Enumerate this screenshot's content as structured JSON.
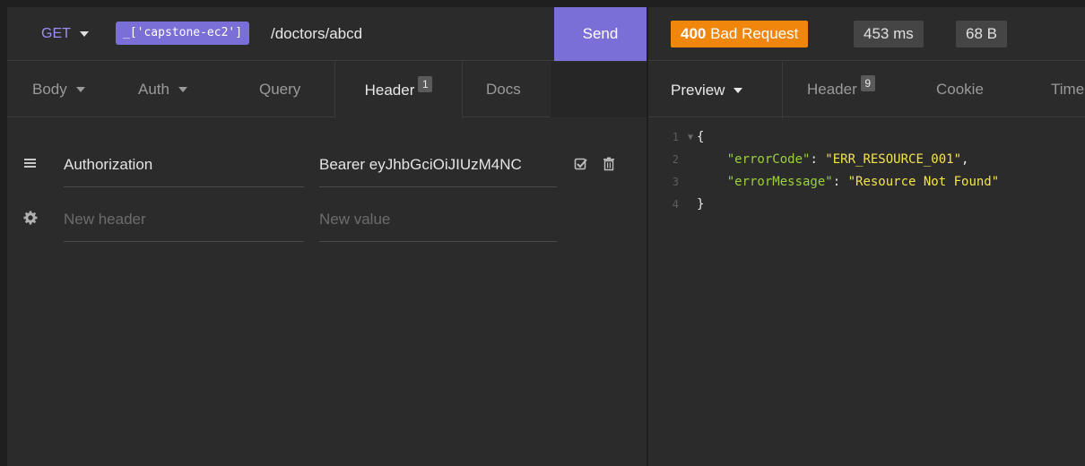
{
  "request": {
    "method": "GET",
    "environment_tag": "_['capstone-ec2']",
    "path": "/doctors/abcd",
    "send_label": "Send"
  },
  "request_tabs": [
    {
      "label": "Body",
      "dropdown": true
    },
    {
      "label": "Auth",
      "dropdown": true
    },
    {
      "label": "Query",
      "dropdown": false
    },
    {
      "label": "Header",
      "badge": "1",
      "active": true
    },
    {
      "label": "Docs",
      "dropdown": false
    }
  ],
  "headers": [
    {
      "name": "Authorization",
      "value": "Bearer eyJhbGciOiJIUzM4NC",
      "icon": "drag-handle-icon"
    }
  ],
  "new_header": {
    "name_placeholder": "New header",
    "value_placeholder": "New value",
    "icon": "gear-icon"
  },
  "response": {
    "status_code": "400",
    "status_text": "Bad Request",
    "time": "453 ms",
    "size": "68 B",
    "status_color": "#f0860b"
  },
  "response_tabs": [
    {
      "label": "Preview",
      "dropdown": true,
      "active": true
    },
    {
      "label": "Header",
      "badge": "9"
    },
    {
      "label": "Cookie"
    },
    {
      "label": "Timel"
    }
  ],
  "response_body": {
    "line_numbers": [
      "1",
      "2",
      "3",
      "4"
    ],
    "open_brace": "{",
    "close_brace": "}",
    "fields": [
      {
        "key": "\"errorCode\"",
        "value": "\"ERR_RESOURCE_001\"",
        "sep": ": ",
        "trail": ","
      },
      {
        "key": "\"errorMessage\"",
        "value": "\"Resource Not Found\"",
        "sep": ": ",
        "trail": ""
      }
    ]
  },
  "colors": {
    "accent": "#7a6fd6",
    "json_key": "#9bd13c",
    "json_string": "#f4e44a"
  }
}
